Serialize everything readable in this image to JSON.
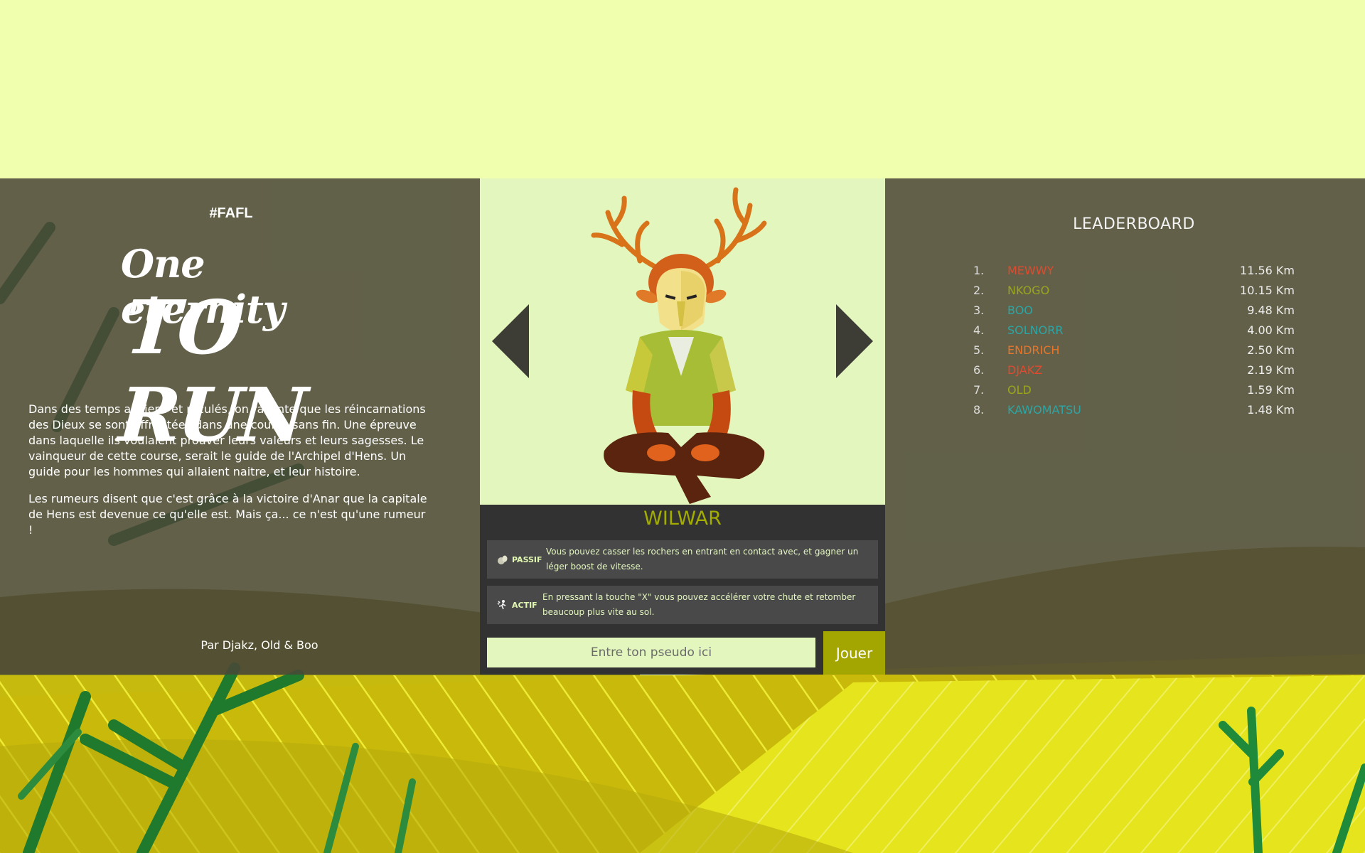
{
  "hashtag": "#FAFL",
  "logo": {
    "line1": "One eternity",
    "line2": "TO RUN"
  },
  "story": [
    "Dans des temps anciens et reculés, on raconte que les réincarnations des Dieux se sont affrontées dans une course sans fin. Une épreuve dans laquelle ils voulaient prouver leurs valeurs et leurs sagesses. Le vainqueur de cette course, serait le guide de l'Archipel d'Hens. Un guide pour les hommes qui allaient naitre, et leur histoire.",
    "Les rumeurs disent que c'est grâce à la victoire d'Anar que la capitale de Hens est devenue ce qu'elle est. Mais ça... ce n'est qu'une rumeur !"
  ],
  "credits": "Par Djakz, Old & Boo",
  "character": {
    "name": "WILWAR",
    "passive": {
      "label": "PASSIF",
      "icon": "rock-icon",
      "text": "Vous pouvez casser les rochers en entrant en contact avec, et gagner un léger boost de vitesse."
    },
    "active": {
      "label": "ACTIF",
      "icon": "fall-icon",
      "text": "En pressant la touche \"X\" vous pouvez accélérer votre chute et retomber beaucoup plus vite au sol."
    }
  },
  "form": {
    "placeholder": "Entre ton pseudo ici",
    "play_label": "Jouer"
  },
  "leaderboard": {
    "title": "LEADERBOARD",
    "entries": [
      {
        "rank": "1.",
        "name": "MEWWY",
        "distance": "11.56 Km",
        "color": "#e04a2f"
      },
      {
        "rank": "2.",
        "name": "NKOGO",
        "distance": "10.15 Km",
        "color": "#9aa61c"
      },
      {
        "rank": "3.",
        "name": "BOO",
        "distance": "9.48 Km",
        "color": "#2aa6a6"
      },
      {
        "rank": "4.",
        "name": "SOLNORR",
        "distance": "4.00 Km",
        "color": "#2aa6a6"
      },
      {
        "rank": "5.",
        "name": "ENDRICH",
        "distance": "2.50 Km",
        "color": "#e8752a"
      },
      {
        "rank": "6.",
        "name": "DJAKZ",
        "distance": "2.19 Km",
        "color": "#e04a2f"
      },
      {
        "rank": "7.",
        "name": "OLD",
        "distance": "1.59 Km",
        "color": "#9aa61c"
      },
      {
        "rank": "8.",
        "name": "KAWOMATSU",
        "distance": "1.48 Km",
        "color": "#2aa6a6"
      }
    ]
  },
  "colors": {
    "sky": "#f0ffad",
    "panel": "#4a4638",
    "portrait_bg": "#e2f6bd",
    "accent": "#a3ad00",
    "info_bg": "#323232"
  }
}
